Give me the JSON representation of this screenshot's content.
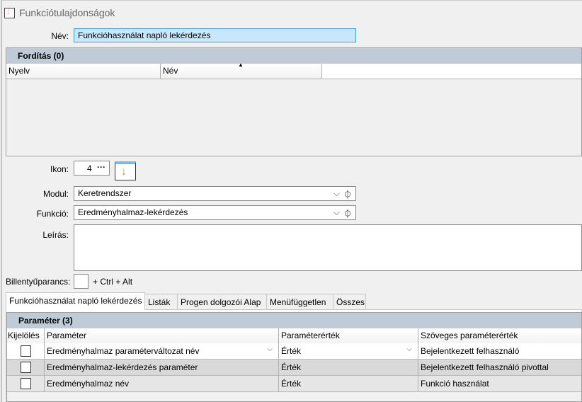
{
  "window": {
    "title": "Funkciótulajdonságok"
  },
  "form": {
    "name_label": "Név:",
    "name_value": "Funkcióhasználat napló lekérdezés",
    "icon_label": "Ikon:",
    "icon_value": "4",
    "icon_more": "···",
    "module_label": "Modul:",
    "module_value": "Keretrendszer",
    "function_label": "Funkció:",
    "function_value": "Eredményhalmaz-lekérdezés",
    "description_label": "Leírás:",
    "description_value": "",
    "shortcut_label": "Billentyűparancs:",
    "shortcut_value": "",
    "shortcut_suffix": "+ Ctrl + Alt"
  },
  "translations": {
    "title": "Fordítás (0)",
    "columns": [
      "Nyelv",
      "Név"
    ]
  },
  "tabs": [
    "Funkcióhasználat napló lekérdezés",
    "Listák",
    "Progen dolgozói Alap",
    "Menüfüggetlen",
    "Összes"
  ],
  "parameters": {
    "title": "Paraméter (3)",
    "columns": [
      "Kijelölés",
      "Paraméter",
      "Paraméterérték",
      "Szöveges paraméterérték"
    ],
    "rows": [
      {
        "param": "Eredményhalmaz paraméterváltozat név",
        "value": "Érték",
        "text": "Bejelentkezett felhasználó"
      },
      {
        "param": "Eredményhalmaz-lekérdezés paraméter",
        "value": "Érték",
        "text": "Bejelentkezett felhasználó pivottal"
      },
      {
        "param": "Eredményhalmaz név",
        "value": "Érték",
        "text": "Funkció használat"
      }
    ]
  }
}
